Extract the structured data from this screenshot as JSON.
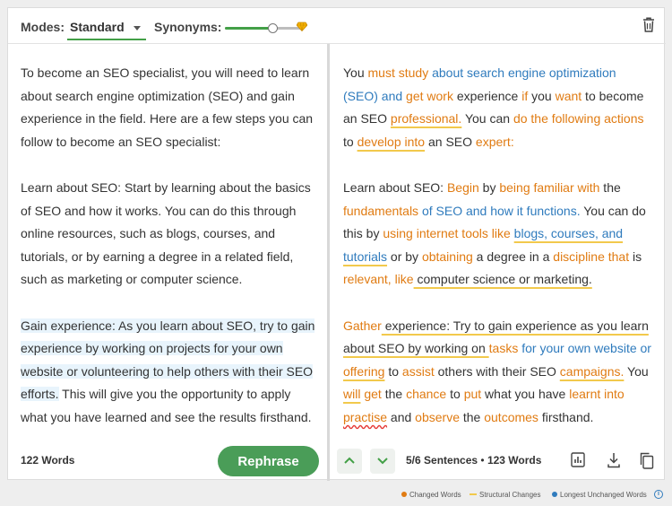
{
  "toolbar": {
    "modes_label": "Modes:",
    "mode_value": "Standard",
    "synonyms_label": "Synonyms:",
    "synonyms_level": 0.62,
    "icons": [
      "chevron-down-icon",
      "gem-icon",
      "trash-icon"
    ]
  },
  "input": {
    "paragraphs": [
      "To become an SEO specialist, you will need to learn about search engine optimization (SEO) and gain experience in the field. Here are a few steps you can follow to become an SEO specialist:",
      "Learn about SEO: Start by learning about the basics of SEO and how it works. You can do this through online resources, such as blogs, courses, and tutorials, or by earning a degree in a related field, such as marketing or computer science.",
      "Gain experience: As you learn about SEO, try to gain experience by working on projects for your own website or volunteering to help others with their SEO efforts. This will give you the opportunity to apply what you have learned and see the results firsthand."
    ],
    "p3_highlight": "Gain experience: As you learn about SEO, try to gain experience by working on projects for your own website or volunteering to help others with their SEO efforts.",
    "p3_rest": " This will give you the opportunity to apply what you have learned and see the results firsthand.",
    "word_count": "122 Words"
  },
  "output": {
    "p1": [
      {
        "t": "You ",
        "k": ""
      },
      {
        "t": "must study",
        "k": "c"
      },
      {
        "t": " ",
        "k": ""
      },
      {
        "t": "about search engine optimization (SEO) and",
        "k": "l"
      },
      {
        "t": " ",
        "k": ""
      },
      {
        "t": "get work",
        "k": "c"
      },
      {
        "t": " experience ",
        "k": ""
      },
      {
        "t": "if",
        "k": "c"
      },
      {
        "t": " you ",
        "k": ""
      },
      {
        "t": "want",
        "k": "c"
      },
      {
        "t": " to become an SEO ",
        "k": ""
      },
      {
        "t": "professional.",
        "k": "c"
      },
      {
        "t": " You can ",
        "k": ""
      },
      {
        "t": "do the following actions",
        "k": "c"
      },
      {
        "t": " to ",
        "k": ""
      },
      {
        "t": "develop into",
        "k": "c"
      },
      {
        "t": " an SEO ",
        "k": ""
      },
      {
        "t": "expert:",
        "k": "c"
      }
    ],
    "p2": [
      {
        "t": "Learn about SEO: ",
        "k": ""
      },
      {
        "t": "Begin",
        "k": "c"
      },
      {
        "t": " by ",
        "k": ""
      },
      {
        "t": "being familiar with",
        "k": "c"
      },
      {
        "t": " the ",
        "k": ""
      },
      {
        "t": "fundamentals",
        "k": "c"
      },
      {
        "t": " ",
        "k": ""
      },
      {
        "t": "of SEO and how it functions.",
        "k": "l"
      },
      {
        "t": " You can do this by ",
        "k": ""
      },
      {
        "t": "using internet tools like",
        "k": "c"
      },
      {
        "t": " ",
        "k": ""
      },
      {
        "t": "blogs, courses, and tutorials",
        "k": "l"
      },
      {
        "t": " or by ",
        "k": ""
      },
      {
        "t": "obtaining",
        "k": "c"
      },
      {
        "t": " a degree in a ",
        "k": ""
      },
      {
        "t": "discipline that",
        "k": "c"
      },
      {
        "t": " is ",
        "k": ""
      },
      {
        "t": "relevant, like",
        "k": "c"
      },
      {
        "t": " computer science or marketing.",
        "k": ""
      }
    ],
    "p3": [
      {
        "t": "Gather",
        "k": "c"
      },
      {
        "t": " experience: Try to gain experience as you learn about SEO by working on ",
        "k": ""
      },
      {
        "t": "tasks",
        "k": "c"
      },
      {
        "t": " ",
        "k": ""
      },
      {
        "t": "for your own website or",
        "k": "l"
      },
      {
        "t": " ",
        "k": ""
      },
      {
        "t": "offering",
        "k": "c"
      },
      {
        "t": " to ",
        "k": ""
      },
      {
        "t": "assist",
        "k": "c"
      },
      {
        "t": " others with their SEO ",
        "k": ""
      },
      {
        "t": "campaigns.",
        "k": "c"
      },
      {
        "t": " You ",
        "k": ""
      },
      {
        "t": "will",
        "k": "c"
      },
      {
        "t": " ",
        "k": ""
      },
      {
        "t": "get",
        "k": "c"
      },
      {
        "t": " the ",
        "k": ""
      },
      {
        "t": "chance",
        "k": "c"
      },
      {
        "t": " to ",
        "k": ""
      },
      {
        "t": "put",
        "k": "c"
      },
      {
        "t": " what you have ",
        "k": ""
      },
      {
        "t": "learnt into",
        "k": "c"
      },
      {
        "t": " ",
        "k": ""
      },
      {
        "t": "practise",
        "k": "cw"
      },
      {
        "t": " and ",
        "k": ""
      },
      {
        "t": "observe",
        "k": "c"
      },
      {
        "t": " the ",
        "k": ""
      },
      {
        "t": "outcomes",
        "k": "c"
      },
      {
        "t": " firsthand.",
        "k": ""
      }
    ],
    "sentences": "5/6 Sentences",
    "word_count": "123 Words",
    "icons": [
      "chevron-up-icon",
      "chevron-down-icon",
      "bar-chart-icon",
      "download-icon",
      "copy-icon"
    ]
  },
  "rephrase_label": "Rephrase",
  "legend": {
    "changed": "Changed Words",
    "structural": "Structural Changes",
    "longest": "Longest Unchanged Words"
  },
  "colors": {
    "changed": "#e07b12",
    "longest": "#2f7bbd",
    "structural": "#f2c94c",
    "accent": "#43a047",
    "button": "#4a9d58"
  }
}
